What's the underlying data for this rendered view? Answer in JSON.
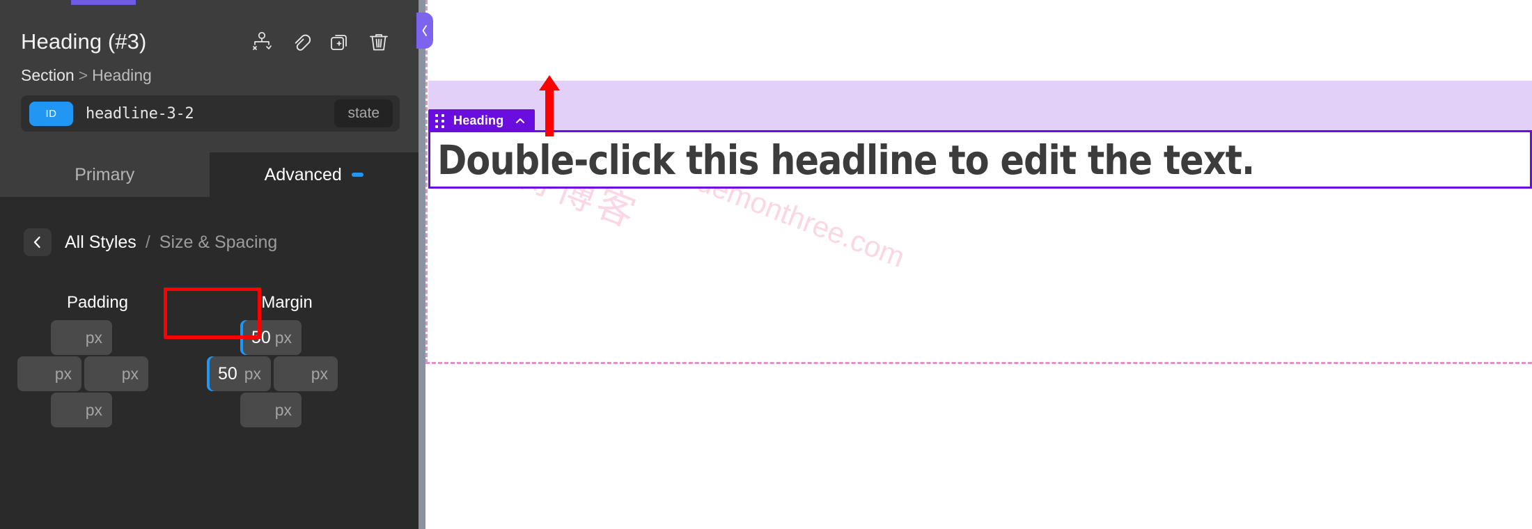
{
  "panel": {
    "title": "Heading (#3)",
    "breadcrumb": {
      "parent": "Section",
      "separator": ">",
      "current": "Heading"
    },
    "id_row": {
      "chip_label": "ID",
      "value": "headline-3-2",
      "state_label": "state"
    },
    "header_icons": [
      {
        "name": "conditions-icon",
        "title": "Conditions"
      },
      {
        "name": "link-icon",
        "title": "Link"
      },
      {
        "name": "duplicate-icon",
        "title": "Duplicate"
      },
      {
        "name": "trash-icon",
        "title": "Delete"
      }
    ],
    "tabs": [
      {
        "label": "Primary",
        "active": false
      },
      {
        "label": "Advanced",
        "active": true,
        "has_dot": true
      }
    ],
    "sub_breadcrumb": {
      "root": "All Styles",
      "separator": "/",
      "current": "Size & Spacing"
    },
    "spacing": {
      "padding": {
        "label": "Padding",
        "top": {
          "value": "",
          "unit": "px",
          "active": false
        },
        "left": {
          "value": "",
          "unit": "px",
          "active": false
        },
        "right": {
          "value": "",
          "unit": "px",
          "active": false
        },
        "bottom": {
          "value": "",
          "unit": "px",
          "active": false
        }
      },
      "margin": {
        "label": "Margin",
        "top": {
          "value": "50",
          "unit": "px",
          "active": true
        },
        "left": {
          "value": "50",
          "unit": "px",
          "active": true
        },
        "right": {
          "value": "",
          "unit": "px",
          "active": false
        },
        "bottom": {
          "value": "",
          "unit": "px",
          "active": false
        }
      }
    }
  },
  "canvas": {
    "heading_badge": {
      "label": "Heading",
      "grip_icon": "drag-grip-icon",
      "chevron_icon": "chevron-up-icon"
    },
    "heading_text": "Double-click this headline to edit the text.",
    "watermark_url": "https://www.xiaodemonthree.com",
    "watermark_cn": "晓得博客",
    "collapse_icon": "chevron-left-icon"
  },
  "colors": {
    "accent_blue": "#2196f3",
    "accent_purple": "#6a0ddf",
    "tab_purple": "#7d64ef",
    "section_fill": "#e3d0f8",
    "highlight_red": "#ff0000",
    "guide_pink": "#e48fc8",
    "panel_bg": "#2a2a2a",
    "panel_head_bg": "#3d3d3d"
  }
}
